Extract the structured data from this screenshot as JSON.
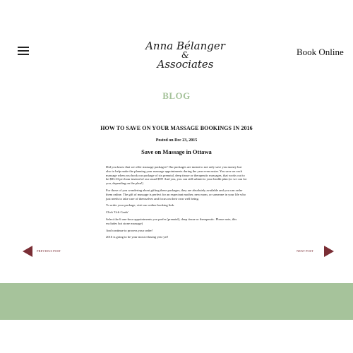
{
  "header": {
    "menu_icon": "hamburger-menu-icon",
    "logo": {
      "line1": "Anna Bélanger",
      "line2": "&",
      "line3": "Associates"
    },
    "book_online": "Book Online"
  },
  "blog": {
    "heading": "BLOG"
  },
  "post": {
    "title": "HOW TO SAVE ON YOUR MASSAGE BOOKINGS IN 2016",
    "date": "Posted on Dec 23, 2015",
    "subtitle": "Save on Massage in Ottawa",
    "paragraphs": [
      "Did you know that we offer massage packages? Our packages are meant to not only save you money but also to help make the planning your massage appointments during the year even easier. You save on each massage when you book our package of six prenatal, deep tissue or therapeutic massages, that works out to be $83.33 per hour instead of our usual $95! And you, you can still submit to your health plan (or we can for you, depending on the plan!)",
      "For those of you wondering about gifting these packages, they are absolutely available and you can order them online. The gift of massage is perfect for an expectant mother, new mom, or someone in your life who just needs to take care of themselves and focus on their own well being.",
      "To order your package, visit our online booking link.",
      "Click 'Gift Cards'",
      "Select the 6 one-hour appointments you prefer (prenatal), deep tissue or therapeutic. Please note, this excludes hot stone massage)",
      "And continue to process your order!",
      "2016 is going to be your most relaxing year yet!"
    ]
  },
  "navigation": {
    "previous_label": "PREVIOUS POST",
    "next_label": "NEXT POST"
  },
  "colors": {
    "accent_green": "#a6c39b",
    "nav_arrow": "#7a2e35"
  }
}
